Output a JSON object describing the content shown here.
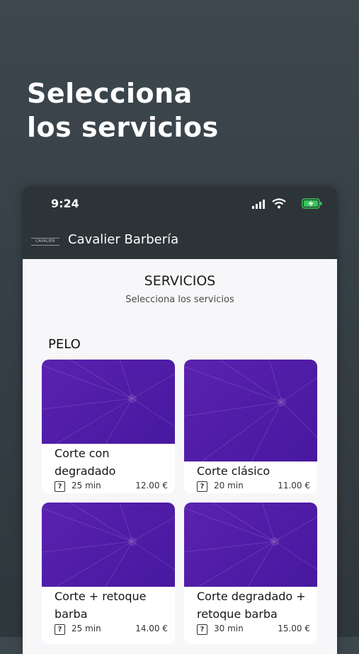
{
  "headline": {
    "line1": "Selecciona",
    "line2": "los servicios"
  },
  "status_bar": {
    "time": "9:24"
  },
  "app_bar": {
    "logo_text": "CAVALIER",
    "title": "Cavalier Barbería"
  },
  "section": {
    "title": "SERVICIOS",
    "subtitle": "Selecciona los servicios"
  },
  "category": "PELO",
  "services": [
    {
      "name": "Corte con degradado",
      "duration": "25 min",
      "price": "12.00 €"
    },
    {
      "name": "Corte clásico",
      "duration": "20 min",
      "price": "11.00 €"
    },
    {
      "name": "Corte + retoque barba",
      "duration": "25 min",
      "price": "14.00 €"
    },
    {
      "name": "Corte degradado + retoque barba",
      "duration": "30 min",
      "price": "15.00 €"
    }
  ],
  "icons": {
    "duration": "clock-icon",
    "signal": "signal-icon",
    "wifi": "wifi-icon",
    "battery": "battery-charging-icon"
  },
  "colors": {
    "background": "#38434a",
    "app_bar": "#2d3438",
    "card_image": "#5220aa",
    "battery": "#35c759"
  }
}
